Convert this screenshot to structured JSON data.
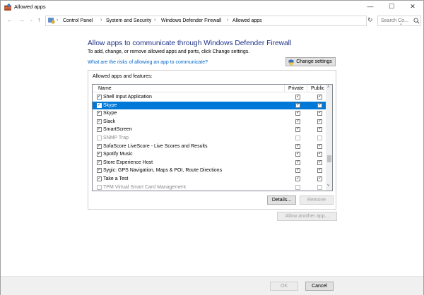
{
  "window": {
    "title": "Allowed apps",
    "controls": {
      "minimize": "—",
      "maximize": "☐",
      "close": "✕"
    }
  },
  "navigation": {
    "back": "←",
    "forward": "→",
    "recent": "⌄",
    "up": "↑",
    "breadcrumbs": [
      "Control Panel",
      "System and Security",
      "Windows Defender Firewall",
      "Allowed apps"
    ],
    "separator": "›",
    "search_placeholder": "Search Co...",
    "refresh": "↻",
    "dropdown": "⌄"
  },
  "main": {
    "heading": "Allow apps to communicate through Windows Defender Firewall",
    "subtext": "To add, change, or remove allowed apps and ports, click Change settings.",
    "risk_link": "What are the risks of allowing an app to communicate?",
    "change_settings": "Change settings",
    "group_label": "Allowed apps and features:",
    "columns": {
      "name": "Name",
      "private": "Private",
      "public": "Public"
    },
    "rows": [
      {
        "name": "Shell Input Application",
        "enabled": true,
        "private": true,
        "public": true
      },
      {
        "name": "Skype",
        "enabled": true,
        "private": true,
        "public": true
      },
      {
        "name": "Skype",
        "enabled": true,
        "private": true,
        "public": true
      },
      {
        "name": "Slack",
        "enabled": true,
        "private": true,
        "public": true
      },
      {
        "name": "SmartScreen",
        "enabled": true,
        "private": true,
        "public": true
      },
      {
        "name": "SNMP Trap",
        "enabled": false,
        "private": false,
        "public": false
      },
      {
        "name": "SofaScore LiveScore - Live Scores and Results",
        "enabled": true,
        "private": true,
        "public": true
      },
      {
        "name": "Spotify Music",
        "enabled": true,
        "private": true,
        "public": true
      },
      {
        "name": "Store Experience Host",
        "enabled": true,
        "private": true,
        "public": true
      },
      {
        "name": "Sygic: GPS Navigation, Maps & POI, Route Directions",
        "enabled": true,
        "private": true,
        "public": true
      },
      {
        "name": "Take a Test",
        "enabled": true,
        "private": true,
        "public": true
      },
      {
        "name": "TPM Virtual Smart Card Management",
        "enabled": false,
        "private": false,
        "public": false
      }
    ],
    "selected_row": 1,
    "details": "Details...",
    "remove": "Remove",
    "allow_another": "Allow another app..."
  },
  "footer": {
    "ok": "OK",
    "cancel": "Cancel"
  },
  "check_mark": "✓",
  "scroll": {
    "up": "˄",
    "down": "˅"
  },
  "colors": {
    "heading": "#1e3287",
    "link": "#0066cc",
    "selection": "#0078d7"
  }
}
